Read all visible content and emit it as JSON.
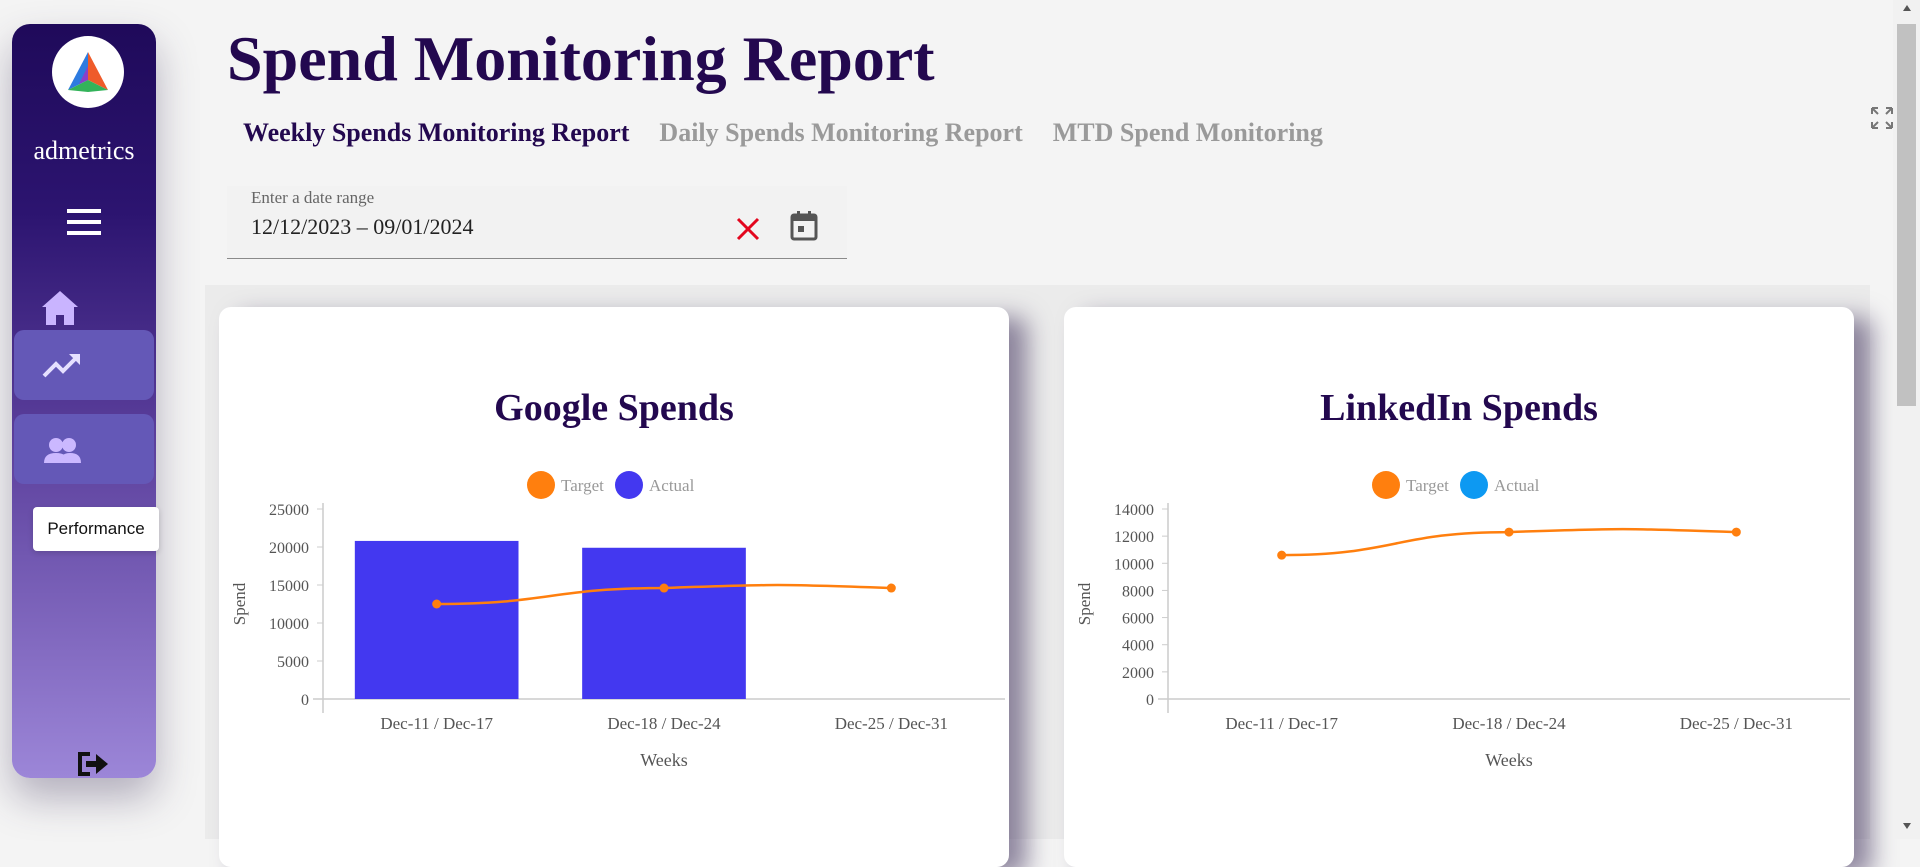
{
  "sidebar": {
    "brand": "admetrics",
    "tooltip": "Performance"
  },
  "header": {
    "title": "Spend Monitoring Report",
    "tabs": [
      {
        "label": "Weekly Spends Monitoring Report",
        "active": true
      },
      {
        "label": "Daily Spends Monitoring Report",
        "active": false
      },
      {
        "label": "MTD Spend Monitoring",
        "active": false
      }
    ]
  },
  "date_range": {
    "label": "Enter a date range",
    "value": "12/12/2023 – 09/01/2024"
  },
  "colors": {
    "title": "#23084f",
    "target": "#ff7f0e",
    "google_actual": "#4338f0",
    "linkedin_actual": "#0d99f2",
    "clear_icon": "#e3061e"
  },
  "chart_data": [
    {
      "type": "bar",
      "title": "Google Spends",
      "xlabel": "Weeks",
      "ylabel": "Spend",
      "categories": [
        "Dec-11 / Dec-17",
        "Dec-18 / Dec-24",
        "Dec-25 / Dec-31"
      ],
      "ylim": [
        0,
        25000
      ],
      "yticks": [
        0,
        5000,
        10000,
        15000,
        20000,
        25000
      ],
      "legend_position": "top",
      "series": [
        {
          "name": "Target",
          "type": "line",
          "color": "#ff7f0e",
          "values": [
            12500,
            14600,
            14600
          ]
        },
        {
          "name": "Actual",
          "type": "bar",
          "color": "#4338f0",
          "values": [
            20800,
            19900,
            0
          ]
        }
      ]
    },
    {
      "type": "line",
      "title": "LinkedIn Spends",
      "xlabel": "Weeks",
      "ylabel": "Spend",
      "categories": [
        "Dec-11 / Dec-17",
        "Dec-18 / Dec-24",
        "Dec-25 / Dec-31"
      ],
      "ylim": [
        0,
        14000
      ],
      "yticks": [
        0,
        2000,
        4000,
        6000,
        8000,
        10000,
        12000,
        14000
      ],
      "legend_position": "top",
      "series": [
        {
          "name": "Target",
          "type": "line",
          "color": "#ff7f0e",
          "values": [
            10600,
            12300,
            12300
          ]
        },
        {
          "name": "Actual",
          "type": "bar",
          "color": "#0d99f2",
          "values": [
            0,
            0,
            0
          ]
        }
      ]
    }
  ]
}
